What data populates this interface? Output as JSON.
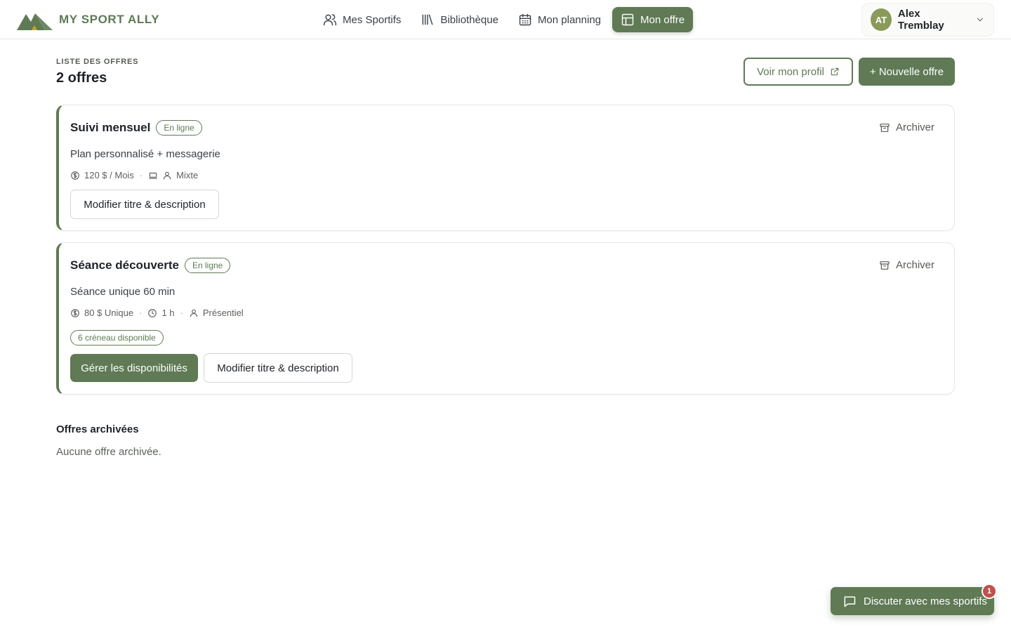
{
  "brand": {
    "name": "MY SPORT ALLY"
  },
  "nav": {
    "items": [
      {
        "label": "Mes Sportifs",
        "icon": "users-icon",
        "active": false
      },
      {
        "label": "Bibliothèque",
        "icon": "library-icon",
        "active": false
      },
      {
        "label": "Mon planning",
        "icon": "calendar-icon",
        "active": false
      },
      {
        "label": "Mon offre",
        "icon": "layout-icon",
        "active": true
      }
    ]
  },
  "user": {
    "initials": "AT",
    "name": "Alex Tremblay"
  },
  "page": {
    "eyebrow": "LISTE DES OFFRES",
    "title": "2 offres",
    "view_profile_label": "Voir mon profil",
    "new_offer_label": "+ Nouvelle offre"
  },
  "offers": [
    {
      "title": "Suivi mensuel",
      "status": "En ligne",
      "archive_label": "Archiver",
      "description": "Plan personnalisé + messagerie",
      "price": "120 $ / Mois",
      "mode": "Mixte",
      "edit_label": "Modifier titre & description"
    },
    {
      "title": "Séance découverte",
      "status": "En ligne",
      "archive_label": "Archiver",
      "description": "Séance unique 60 min",
      "price": "80 $ Unique",
      "duration": "1 h",
      "mode": "Présentiel",
      "slots": "6 créneau disponible",
      "manage_label": "Gérer les disponibilités",
      "edit_label": "Modifier titre & description"
    }
  ],
  "archived": {
    "title": "Offres archivées",
    "empty_text": "Aucune offre archivée."
  },
  "chat": {
    "label": "Discuter avec mes sportifs",
    "badge": "1"
  },
  "colors": {
    "accent": "#5f7a55",
    "avatar": "#8a9a5b",
    "badge": "#c0504d"
  }
}
